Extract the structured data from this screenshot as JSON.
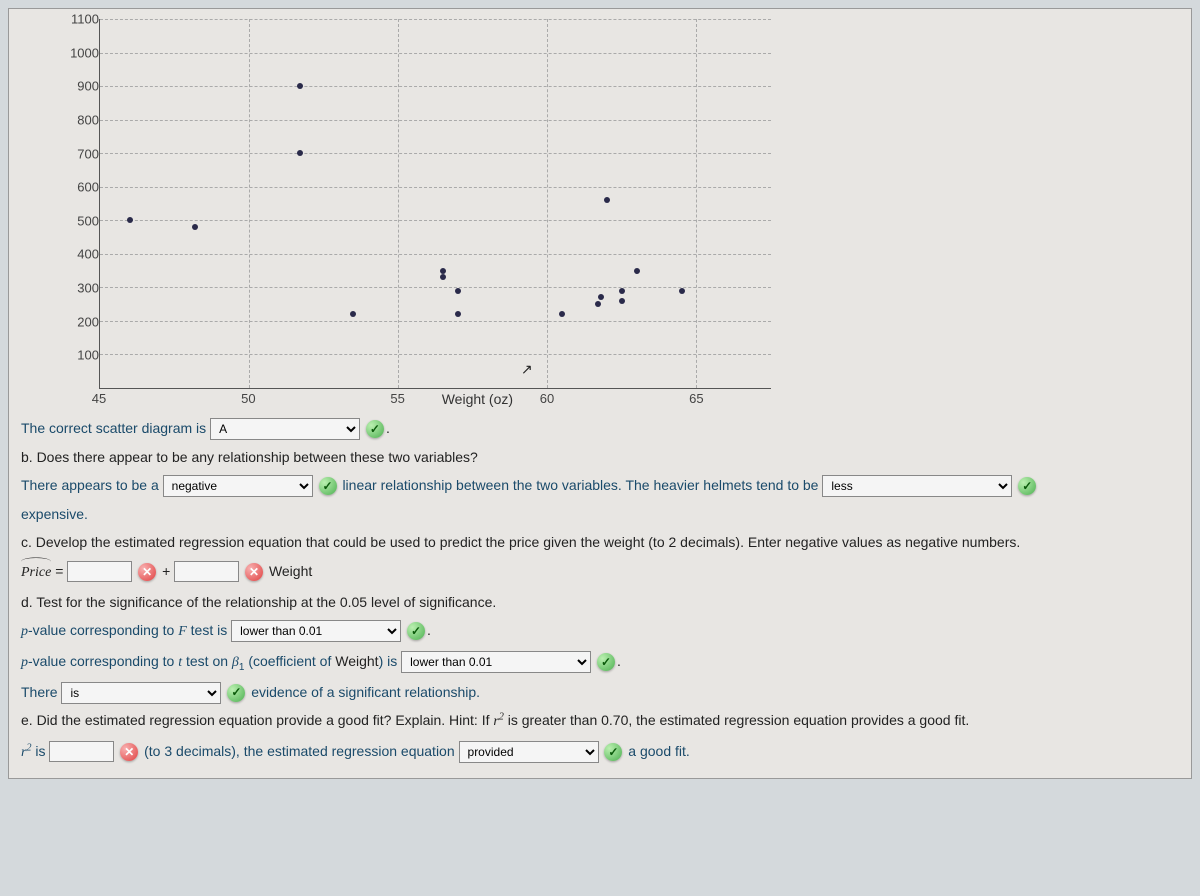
{
  "chart_data": {
    "type": "scatter",
    "xlabel": "Weight (oz)",
    "ylabel": "",
    "xlim": [
      45,
      67.5
    ],
    "ylim": [
      0,
      1100
    ],
    "x_ticks": [
      45,
      50,
      55,
      60,
      65
    ],
    "y_ticks": [
      100,
      200,
      300,
      400,
      500,
      600,
      700,
      800,
      900,
      1000,
      1100
    ],
    "points": [
      {
        "x": 46.0,
        "y": 500
      },
      {
        "x": 48.2,
        "y": 480
      },
      {
        "x": 51.7,
        "y": 900
      },
      {
        "x": 51.7,
        "y": 700
      },
      {
        "x": 53.5,
        "y": 220
      },
      {
        "x": 56.5,
        "y": 330
      },
      {
        "x": 56.5,
        "y": 350
      },
      {
        "x": 57.0,
        "y": 290
      },
      {
        "x": 57.0,
        "y": 220
      },
      {
        "x": 60.5,
        "y": 220
      },
      {
        "x": 61.7,
        "y": 250
      },
      {
        "x": 61.8,
        "y": 270
      },
      {
        "x": 62.0,
        "y": 560
      },
      {
        "x": 62.5,
        "y": 290
      },
      {
        "x": 62.5,
        "y": 260
      },
      {
        "x": 63.0,
        "y": 350
      },
      {
        "x": 64.5,
        "y": 290
      }
    ]
  },
  "text": {
    "scatter_intro": "The correct scatter diagram is",
    "scatter_answer": "A",
    "b_question": "b. Does there appear to be any relationship between these two variables?",
    "b_lead": "There appears to be a",
    "b_choice1": "negative",
    "b_mid": "linear relationship between the two variables. The heavier helmets tend to be",
    "b_choice2": "less",
    "b_tail": "expensive.",
    "c_question": "c. Develop the estimated regression equation that could be used to predict the price given the weight (to 2 decimals). Enter negative values as negative numbers.",
    "price_label": "Price",
    "equals": " = ",
    "plus": " + ",
    "weight_word": "Weight",
    "d_question": "d. Test for the significance of the relationship at the 0.05 level of significance.",
    "d_f_lead": "p-value corresponding to ",
    "d_f_mid": " test is",
    "d_f_choice": "lower than 0.01",
    "d_t_lead": "p-value corresponding to ",
    "d_t_mid1": " test on ",
    "d_t_beta": "β",
    "d_t_sub": "1",
    "d_t_mid2": " (coefficient of ",
    "d_t_mid3": ") is",
    "d_t_choice": "lower than 0.01",
    "d_there": "There",
    "d_is_choice": "is",
    "d_evidence": "evidence of a significant relationship.",
    "e_question": "e. Did the estimated regression equation provide a good fit? Explain. Hint: If ",
    "e_question2": " is greater than 0.70, the estimated regression equation provides a good fit.",
    "e_r2": "r",
    "e_is": " is ",
    "e_mid": "(to 3 decimals), the estimated regression equation",
    "e_choice": "provided",
    "e_tail": "a good fit.",
    "F": "F",
    "t": "t",
    "period": "."
  }
}
